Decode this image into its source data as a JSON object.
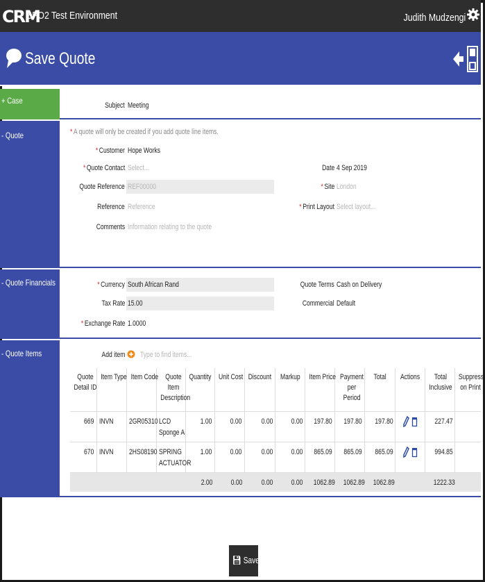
{
  "app": {
    "logo": "CRM",
    "env_title": "BPO2 Test Environment",
    "user_name": "Judith Mudzengi"
  },
  "header": {
    "title": "Save Quote"
  },
  "colors": {
    "primary": "#3a4ca6",
    "case": "#5aab47",
    "topbar": "#2e2e2e",
    "required": "#d42b2b"
  },
  "case": {
    "label": "+ Case",
    "subject_label": "Subject",
    "subject_value": "Meeting"
  },
  "quote": {
    "label": "- Quote",
    "note": "A quote will only be created if you add quote line items.",
    "customer_label": "Customer",
    "customer_value": "Hope Works",
    "contact_label": "Quote Contact",
    "contact_placeholder": "Select...",
    "date_label": "Date",
    "date_value": "4 Sep 2019",
    "reference_label": "Quote Reference",
    "reference_placeholder": "REF00000",
    "site_label": "Site",
    "site_placeholder": "London",
    "ref2_label": "Reference",
    "ref2_placeholder": "Reference",
    "layout_label": "Print Layout",
    "layout_placeholder": "Select layout...",
    "comments_label": "Comments",
    "comments_placeholder": "Information relating to the quote"
  },
  "financials": {
    "label": "- Quote Financials",
    "currency_label": "Currency",
    "currency_value": "South African Rand",
    "terms_label": "Quote Terms",
    "terms_value": "Cash on Delivery",
    "tax_label": "Tax Rate",
    "tax_value": "15.00",
    "commercial_label": "Commercial",
    "commercial_value": "Default",
    "exchange_label": "Exchange Rate",
    "exchange_value": "1.0000"
  },
  "items": {
    "label": "- Quote Items",
    "add_label": "Add item",
    "search_placeholder": "Type to find items...",
    "columns": [
      "Quote Detail ID",
      "Item Type",
      "Item Code",
      "Quote Item Description",
      "Quantity",
      "Unit Cost",
      "Discount",
      "Markup",
      "Item Price",
      "Payment per Period",
      "Total",
      "Actions",
      "Total Inclusive",
      "Suppress on Print"
    ],
    "rows": [
      {
        "id": "669",
        "type": "INVN",
        "code": "2GR05310",
        "desc": [
          "LCD",
          "Sponge A"
        ],
        "qty": "1.00",
        "unit_cost": "0.00",
        "discount": "0.00",
        "markup": "0.00",
        "item_price": "197.80",
        "payment": "197.80",
        "total": "197.80",
        "total_incl": "227.47"
      },
      {
        "id": "670",
        "type": "INVN",
        "code": "2HS08190",
        "desc": [
          "SPRING",
          "ACTUATOR"
        ],
        "qty": "1.00",
        "unit_cost": "0.00",
        "discount": "0.00",
        "markup": "0.00",
        "item_price": "865.09",
        "payment": "865.09",
        "total": "865.09",
        "total_incl": "994.85"
      }
    ],
    "totals": {
      "qty": "2.00",
      "unit_cost": "0.00",
      "discount": "0.00",
      "markup": "0.00",
      "item_price": "1062.89",
      "payment": "1062.89",
      "total": "1062.89",
      "total_incl": "1222.33"
    }
  },
  "footer": {
    "save_label": "Save"
  }
}
